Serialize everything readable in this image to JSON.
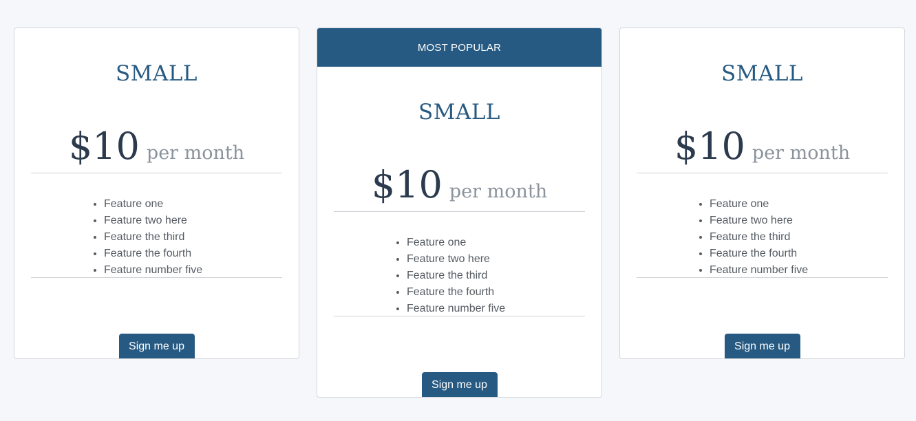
{
  "colors": {
    "brand": "#275a82",
    "background": "#f5f7fa",
    "price_text": "#2c3a4d",
    "period_text": "#8a939c",
    "feature_text": "#555b62"
  },
  "plans": [
    {
      "badge": null,
      "title": "SMALL",
      "price": "$10",
      "period": "per month",
      "features": [
        "Feature one",
        "Feature two here",
        "Feature the third",
        "Feature the fourth",
        "Feature number five"
      ],
      "cta": "Sign me up"
    },
    {
      "badge": "MOST POPULAR",
      "title": "SMALL",
      "price": "$10",
      "period": "per month",
      "features": [
        "Feature one",
        "Feature two here",
        "Feature the third",
        "Feature the fourth",
        "Feature number five"
      ],
      "cta": "Sign me up"
    },
    {
      "badge": null,
      "title": "SMALL",
      "price": "$10",
      "period": "per month",
      "features": [
        "Feature one",
        "Feature two here",
        "Feature the third",
        "Feature the fourth",
        "Feature number five"
      ],
      "cta": "Sign me up"
    }
  ]
}
